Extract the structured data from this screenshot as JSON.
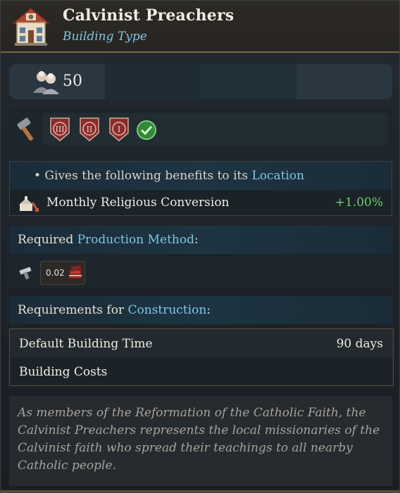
{
  "header": {
    "title": "Calvinist Preachers",
    "subtitle": "Building Type",
    "icon": "building-house-icon"
  },
  "stats": {
    "population_value": "50",
    "icons": [
      "population-icon",
      "religion-sun-icon",
      "rank-chevrons-icon",
      "city-icon"
    ],
    "chevron_color": "#2f8fd8"
  },
  "tiers": {
    "icons": [
      "hammer-icon",
      "tier-3-shield-icon",
      "tier-2-shield-icon",
      "tier-1-shield-icon",
      "checkmark-icon"
    ],
    "labels": [
      "III",
      "II",
      "I"
    ]
  },
  "benefits": {
    "intro_prefix": "• Gives the following benefits to its ",
    "intro_link": "Location",
    "modifier_label": "Monthly Religious Conversion",
    "modifier_value": "+1.00%",
    "value_color": "#6ccf6a"
  },
  "production": {
    "label_prefix": "Required ",
    "label_link": "Production Method",
    "label_suffix": ":",
    "amount": "0.02",
    "input_icon": "books-icon"
  },
  "construction": {
    "label_prefix": "Requirements for ",
    "label_link": "Construction",
    "label_suffix": ":",
    "rows": [
      {
        "label": "Default Building Time",
        "value": "90 days"
      },
      {
        "label": "Building Costs",
        "value": ""
      }
    ]
  },
  "flavor": {
    "text": "As members of the Reformation of the Catholic Faith, the Calvinist Preachers represents the local missionaries of the Calvinist faith who spread their teachings to all nearby Catholic people."
  },
  "colors": {
    "link_blue": "#7ec6e6",
    "gold_border": "#8c7348"
  }
}
